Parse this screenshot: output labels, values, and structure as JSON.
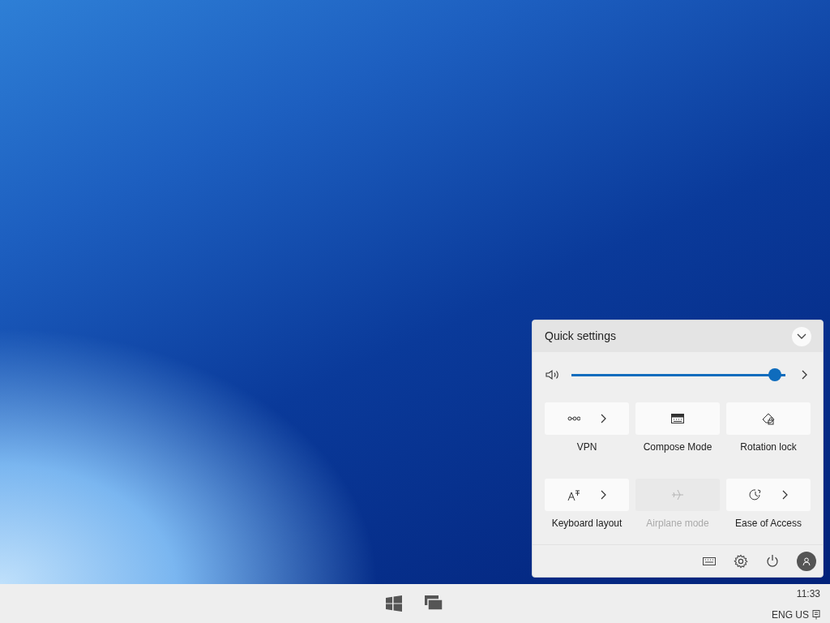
{
  "quick_settings": {
    "title": "Quick settings",
    "volume": {
      "level": 0.98
    },
    "tiles": [
      {
        "label": "VPN",
        "disabled": false,
        "has_more": true
      },
      {
        "label": "Compose Mode",
        "disabled": false,
        "has_more": false
      },
      {
        "label": "Rotation lock",
        "disabled": false,
        "has_more": false
      },
      {
        "label": "Keyboard layout",
        "disabled": false,
        "has_more": true
      },
      {
        "label": "Airplane mode",
        "disabled": true,
        "has_more": false
      },
      {
        "label": "Ease of Access",
        "disabled": false,
        "has_more": true
      }
    ]
  },
  "taskbar": {
    "time": "11:33",
    "language": "ENG US"
  }
}
